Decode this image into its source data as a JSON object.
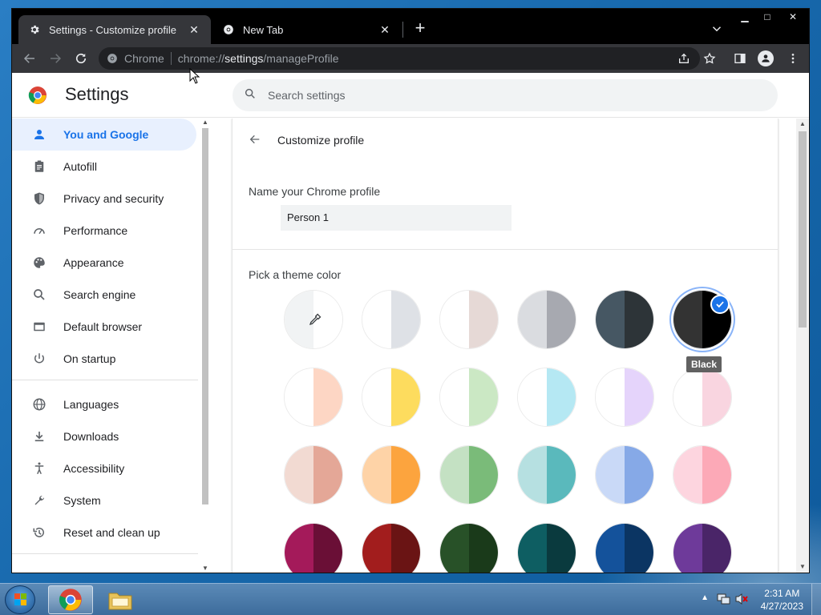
{
  "browser": {
    "tabs": [
      {
        "title": "Settings - Customize profile",
        "icon": "gear-icon",
        "active": true
      },
      {
        "title": "New Tab",
        "icon": "chrome-icon",
        "active": false
      }
    ],
    "omnibox": {
      "site_label": "Chrome",
      "url_scheme": "chrome://",
      "url_host": "settings",
      "url_path": "/manageProfile"
    }
  },
  "settings": {
    "title": "Settings",
    "search_placeholder": "Search settings",
    "nav": [
      {
        "label": "You and Google",
        "icon": "person-icon",
        "selected": true
      },
      {
        "label": "Autofill",
        "icon": "clipboard-icon"
      },
      {
        "label": "Privacy and security",
        "icon": "shield-icon"
      },
      {
        "label": "Performance",
        "icon": "speedometer-icon"
      },
      {
        "label": "Appearance",
        "icon": "palette-icon"
      },
      {
        "label": "Search engine",
        "icon": "search-icon"
      },
      {
        "label": "Default browser",
        "icon": "browser-window-icon"
      },
      {
        "label": "On startup",
        "icon": "power-icon"
      },
      {
        "label": "Languages",
        "icon": "globe-icon"
      },
      {
        "label": "Downloads",
        "icon": "download-icon"
      },
      {
        "label": "Accessibility",
        "icon": "accessibility-icon"
      },
      {
        "label": "System",
        "icon": "wrench-icon"
      },
      {
        "label": "Reset and clean up",
        "icon": "history-icon"
      }
    ],
    "page": {
      "title": "Customize profile",
      "name_label": "Name your Chrome profile",
      "name_value": "Person 1",
      "theme_label": "Pick a theme color",
      "selected_theme": "Black",
      "themes": [
        [
          "#f1f3f4",
          "#ffffff"
        ],
        [
          "#ffffff",
          "#dee1e6"
        ],
        [
          "#ffffff",
          "#e6d9d6"
        ],
        [
          "#dadce0",
          "#a7a9b0"
        ],
        [
          "#465763",
          "#2d3438"
        ],
        [
          "#333333",
          "#000000"
        ],
        [
          "#ffffff",
          "#fdd6c4"
        ],
        [
          "#ffffff",
          "#fddc5e"
        ],
        [
          "#ffffff",
          "#cbe8c4"
        ],
        [
          "#ffffff",
          "#b5e8f3"
        ],
        [
          "#ffffff",
          "#e5d4fb"
        ],
        [
          "#ffffff",
          "#f9d5e0"
        ],
        [
          "#f2dad2",
          "#e4a797"
        ],
        [
          "#fed3a7",
          "#fca43e"
        ],
        [
          "#c4e1c3",
          "#7abb79"
        ],
        [
          "#b6e0e1",
          "#5ab9bc"
        ],
        [
          "#c9d9f7",
          "#86a9e7"
        ],
        [
          "#fdd5df",
          "#fca9b7"
        ],
        [
          "#a41a5a",
          "#6a0f36"
        ],
        [
          "#a21d1d",
          "#6a1414"
        ],
        [
          "#285128",
          "#1a3a1a"
        ],
        [
          "#0e5e62",
          "#0a3a3e"
        ],
        [
          "#14529b",
          "#0b3563"
        ],
        [
          "#6e3a9a",
          "#4a2568"
        ]
      ]
    }
  },
  "taskbar": {
    "time": "2:31 AM",
    "date": "4/27/2023"
  }
}
